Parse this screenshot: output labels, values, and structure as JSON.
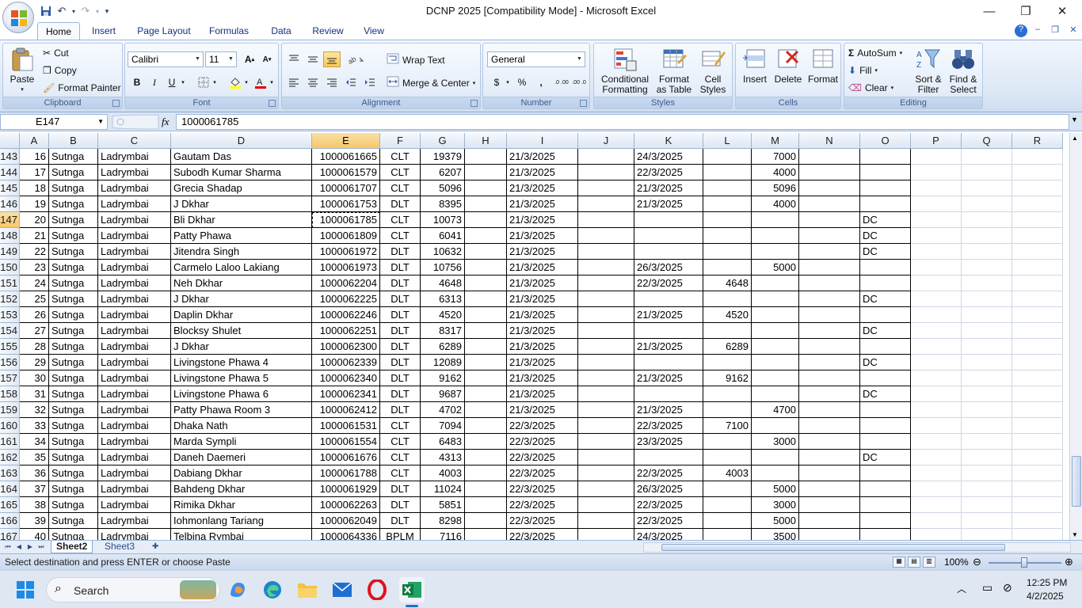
{
  "window": {
    "title": "DCNP 2025  [Compatibility Mode] - Microsoft Excel"
  },
  "ribbon_tabs": [
    "Home",
    "Insert",
    "Page Layout",
    "Formulas",
    "Data",
    "Review",
    "View"
  ],
  "ribbon": {
    "clipboard": {
      "paste": "Paste",
      "cut": "Cut",
      "copy": "Copy",
      "format_painter": "Format Painter",
      "label": "Clipboard"
    },
    "font": {
      "name": "Calibri",
      "size": "11",
      "bold": "B",
      "italic": "I",
      "underline": "U",
      "label": "Font"
    },
    "alignment": {
      "wrap_text": "Wrap Text",
      "merge_center": "Merge & Center",
      "label": "Alignment"
    },
    "number": {
      "format": "General",
      "currency": "$",
      "percent": "%",
      "comma": ",",
      "inc_decimal": ".0 .00",
      "dec_decimal": ".00 .0",
      "label": "Number"
    },
    "styles": {
      "conditional_1": "Conditional",
      "conditional_2": "Formatting",
      "format_table_1": "Format",
      "format_table_2": "as Table",
      "cell_styles_1": "Cell",
      "cell_styles_2": "Styles",
      "label": "Styles"
    },
    "cells": {
      "insert": "Insert",
      "delete": "Delete",
      "format": "Format",
      "label": "Cells"
    },
    "editing": {
      "autosum": "AutoSum",
      "fill": "Fill",
      "clear": "Clear",
      "sort_1": "Sort &",
      "sort_2": "Filter",
      "find_1": "Find &",
      "find_2": "Select",
      "label": "Editing"
    }
  },
  "formula_bar": {
    "name_box": "E147",
    "fx": "fx",
    "value": "1000061785"
  },
  "columns": [
    "A",
    "B",
    "C",
    "D",
    "E",
    "F",
    "G",
    "H",
    "I",
    "J",
    "K",
    "L",
    "M",
    "N",
    "O",
    "P",
    "Q",
    "R"
  ],
  "rows": [
    {
      "n": "143",
      "A": "16",
      "B": "Sutnga",
      "C": "Ladrymbai",
      "D": "Gautam Das",
      "E": "1000061665",
      "F": "CLT",
      "G": "19379",
      "I": "21/3/2025",
      "K": "24/3/2025",
      "L": "",
      "M": "7000",
      "O": ""
    },
    {
      "n": "144",
      "A": "17",
      "B": "Sutnga",
      "C": "Ladrymbai",
      "D": "Subodh Kumar Sharma",
      "E": "1000061579",
      "F": "CLT",
      "G": "6207",
      "I": "21/3/2025",
      "K": "22/3/2025",
      "L": "",
      "M": "4000",
      "O": ""
    },
    {
      "n": "145",
      "A": "18",
      "B": "Sutnga",
      "C": "Ladrymbai",
      "D": "Grecia Shadap",
      "E": "1000061707",
      "F": "CLT",
      "G": "5096",
      "I": "21/3/2025",
      "K": "21/3/2025",
      "L": "",
      "M": "5096",
      "O": ""
    },
    {
      "n": "146",
      "A": "19",
      "B": "Sutnga",
      "C": "Ladrymbai",
      "D": "J Dkhar",
      "E": "1000061753",
      "F": "DLT",
      "G": "8395",
      "I": "21/3/2025",
      "K": "21/3/2025",
      "L": "",
      "M": "4000",
      "O": ""
    },
    {
      "n": "147",
      "A": "20",
      "B": "Sutnga",
      "C": "Ladrymbai",
      "D": "Bli Dkhar",
      "E": "1000061785",
      "F": "CLT",
      "G": "10073",
      "I": "21/3/2025",
      "K": "",
      "L": "",
      "M": "",
      "O": "DC"
    },
    {
      "n": "148",
      "A": "21",
      "B": "Sutnga",
      "C": "Ladrymbai",
      "D": "Patty Phawa",
      "E": "1000061809",
      "F": "CLT",
      "G": "6041",
      "I": "21/3/2025",
      "K": "",
      "L": "",
      "M": "",
      "O": "DC"
    },
    {
      "n": "149",
      "A": "22",
      "B": "Sutnga",
      "C": "Ladrymbai",
      "D": "Jitendra Singh",
      "E": "1000061972",
      "F": "DLT",
      "G": "10632",
      "I": "21/3/2025",
      "K": "",
      "L": "",
      "M": "",
      "O": "DC"
    },
    {
      "n": "150",
      "A": "23",
      "B": "Sutnga",
      "C": "Ladrymbai",
      "D": "Carmelo Laloo Lakiang",
      "E": "1000061973",
      "F": "DLT",
      "G": "10756",
      "I": "21/3/2025",
      "K": "26/3/2025",
      "L": "",
      "M": "5000",
      "O": ""
    },
    {
      "n": "151",
      "A": "24",
      "B": "Sutnga",
      "C": "Ladrymbai",
      "D": "Neh Dkhar",
      "E": "1000062204",
      "F": "DLT",
      "G": "4648",
      "I": "21/3/2025",
      "K": "22/3/2025",
      "L": "4648",
      "M": "",
      "O": ""
    },
    {
      "n": "152",
      "A": "25",
      "B": "Sutnga",
      "C": "Ladrymbai",
      "D": "J Dkhar",
      "E": "1000062225",
      "F": "DLT",
      "G": "6313",
      "I": "21/3/2025",
      "K": "",
      "L": "",
      "M": "",
      "O": "DC"
    },
    {
      "n": "153",
      "A": "26",
      "B": "Sutnga",
      "C": "Ladrymbai",
      "D": "Daplin Dkhar",
      "E": "1000062246",
      "F": "DLT",
      "G": "4520",
      "I": "21/3/2025",
      "K": "21/3/2025",
      "L": "4520",
      "M": "",
      "O": ""
    },
    {
      "n": "154",
      "A": "27",
      "B": "Sutnga",
      "C": "Ladrymbai",
      "D": "Blocksy Shulet",
      "E": "1000062251",
      "F": "DLT",
      "G": "8317",
      "I": "21/3/2025",
      "K": "",
      "L": "",
      "M": "",
      "O": "DC"
    },
    {
      "n": "155",
      "A": "28",
      "B": "Sutnga",
      "C": "Ladrymbai",
      "D": "J Dkhar",
      "E": "1000062300",
      "F": "DLT",
      "G": "6289",
      "I": "21/3/2025",
      "K": "21/3/2025",
      "L": "6289",
      "M": "",
      "O": ""
    },
    {
      "n": "156",
      "A": "29",
      "B": "Sutnga",
      "C": "Ladrymbai",
      "D": "Livingstone Phawa 4",
      "E": "1000062339",
      "F": "DLT",
      "G": "12089",
      "I": "21/3/2025",
      "K": "",
      "L": "",
      "M": "",
      "O": "DC"
    },
    {
      "n": "157",
      "A": "30",
      "B": "Sutnga",
      "C": "Ladrymbai",
      "D": "Livingstone Phawa 5",
      "E": "1000062340",
      "F": "DLT",
      "G": "9162",
      "I": "21/3/2025",
      "K": "21/3/2025",
      "L": "9162",
      "M": "",
      "O": ""
    },
    {
      "n": "158",
      "A": "31",
      "B": "Sutnga",
      "C": "Ladrymbai",
      "D": "Livingstone Phawa 6",
      "E": "1000062341",
      "F": "DLT",
      "G": "9687",
      "I": "21/3/2025",
      "K": "",
      "L": "",
      "M": "",
      "O": "DC"
    },
    {
      "n": "159",
      "A": "32",
      "B": "Sutnga",
      "C": "Ladrymbai",
      "D": "Patty Phawa Room 3",
      "E": "1000062412",
      "F": "DLT",
      "G": "4702",
      "I": "21/3/2025",
      "K": "21/3/2025",
      "L": "",
      "M": "4700",
      "O": ""
    },
    {
      "n": "160",
      "A": "33",
      "B": "Sutnga",
      "C": "Ladrymbai",
      "D": "Dhaka Nath",
      "E": "1000061531",
      "F": "CLT",
      "G": "7094",
      "I": "22/3/2025",
      "K": "22/3/2025",
      "L": "7100",
      "M": "",
      "O": ""
    },
    {
      "n": "161",
      "A": "34",
      "B": "Sutnga",
      "C": "Ladrymbai",
      "D": "Marda Sympli",
      "E": "1000061554",
      "F": "CLT",
      "G": "6483",
      "I": "22/3/2025",
      "K": "23/3/2025",
      "L": "",
      "M": "3000",
      "O": ""
    },
    {
      "n": "162",
      "A": "35",
      "B": "Sutnga",
      "C": "Ladrymbai",
      "D": "Daneh Daemeri",
      "E": "1000061676",
      "F": "CLT",
      "G": "4313",
      "I": "22/3/2025",
      "K": "",
      "L": "",
      "M": "",
      "O": "DC"
    },
    {
      "n": "163",
      "A": "36",
      "B": "Sutnga",
      "C": "Ladrymbai",
      "D": "Dabiang Dkhar",
      "E": "1000061788",
      "F": "CLT",
      "G": "4003",
      "I": "22/3/2025",
      "K": "22/3/2025",
      "L": "4003",
      "M": "",
      "O": ""
    },
    {
      "n": "164",
      "A": "37",
      "B": "Sutnga",
      "C": "Ladrymbai",
      "D": "Bahdeng Dkhar",
      "E": "1000061929",
      "F": "DLT",
      "G": "11024",
      "I": "22/3/2025",
      "K": "26/3/2025",
      "L": "",
      "M": "5000",
      "O": ""
    },
    {
      "n": "165",
      "A": "38",
      "B": "Sutnga",
      "C": "Ladrymbai",
      "D": "Rimika Dkhar",
      "E": "1000062263",
      "F": "DLT",
      "G": "5851",
      "I": "22/3/2025",
      "K": "22/3/2025",
      "L": "",
      "M": "3000",
      "O": ""
    },
    {
      "n": "166",
      "A": "39",
      "B": "Sutnga",
      "C": "Ladrymbai",
      "D": "Iohmonlang Tariang",
      "E": "1000062049",
      "F": "DLT",
      "G": "8298",
      "I": "22/3/2025",
      "K": "22/3/2025",
      "L": "",
      "M": "5000",
      "O": ""
    },
    {
      "n": "167",
      "A": "40",
      "B": "Sutnga",
      "C": "Ladrymbai",
      "D": "Telbina Rymbai",
      "E": "1000064336",
      "F": "BPLM",
      "G": "7116",
      "I": "22/3/2025",
      "K": "24/3/2025",
      "L": "",
      "M": "3500",
      "O": ""
    }
  ],
  "selected": {
    "column": "E",
    "row": "147"
  },
  "sheets": [
    "Sheet2",
    "Sheet3"
  ],
  "status": {
    "message": "Select destination and press ENTER or choose Paste",
    "zoom": "100%"
  },
  "taskbar": {
    "search": "Search",
    "time": "12:25 PM",
    "date": "4/2/2025"
  },
  "colors": {
    "accent": "#f6c76a",
    "ribbon": "#dde8f6",
    "excel_green": "#1e7145"
  }
}
